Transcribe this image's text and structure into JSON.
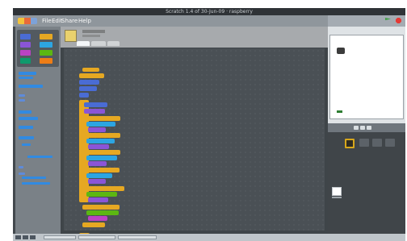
{
  "window": {
    "title": "Scratch 1.4 of 30-Jun-09 · raspberry"
  },
  "menu": {
    "file": "File",
    "edit": "Edit",
    "share": "Share",
    "help": "Help"
  },
  "icons": [
    "scratch-logo-icon",
    "green-flag-icon",
    "stop-icon",
    "paintbrush-icon",
    "star-icon",
    "folder-icon"
  ]
}
